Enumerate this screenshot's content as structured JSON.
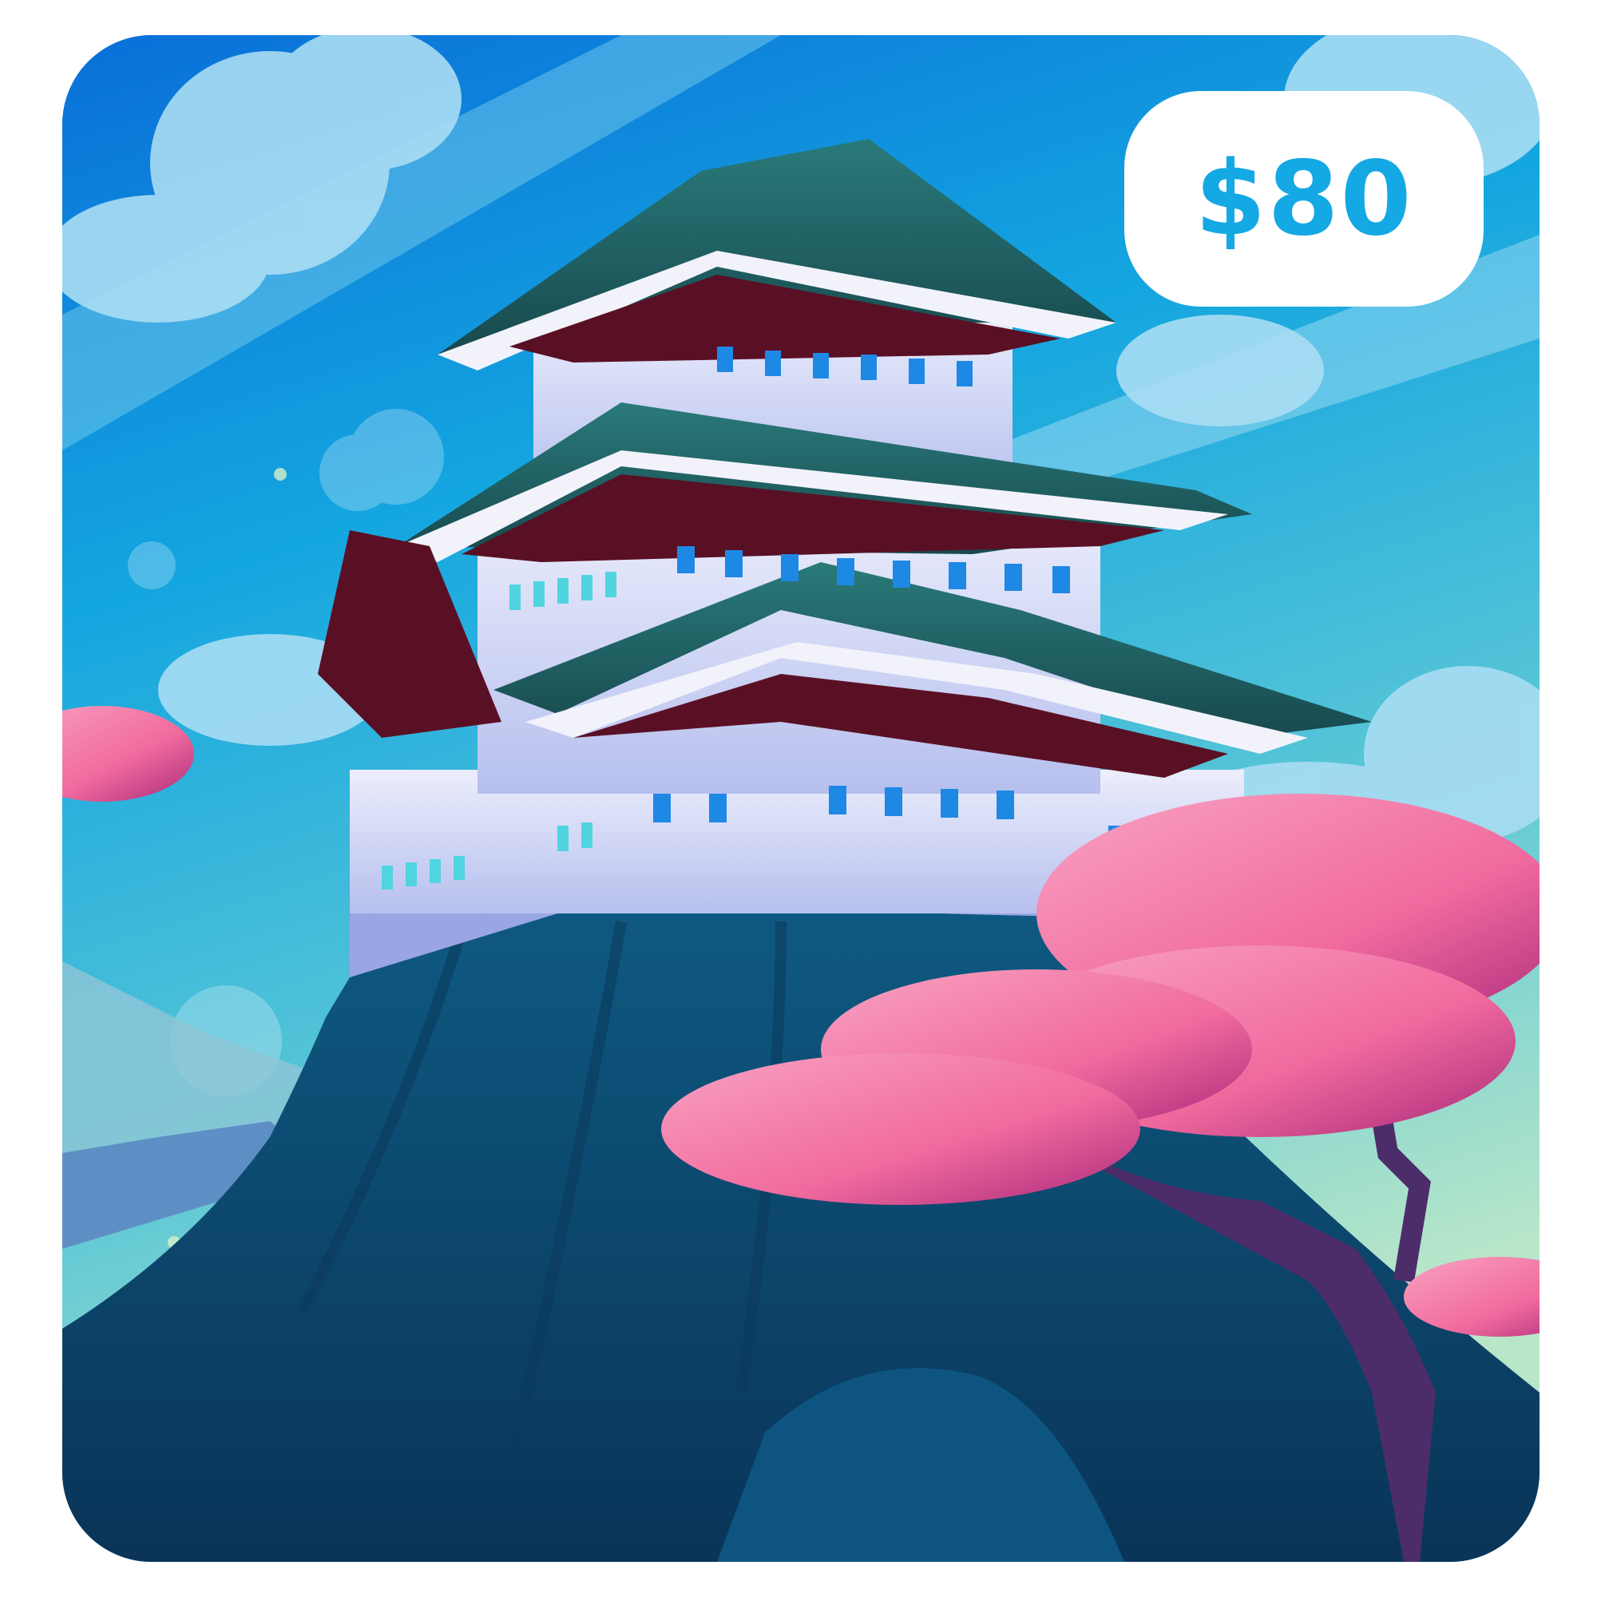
{
  "item": {
    "price": "$80"
  },
  "colors": {
    "price_text": "#14a8e4",
    "badge_background": "#ffffff",
    "sky_top": "#0a74da",
    "blossom": "#f07aa8",
    "rock": "#0f4a70",
    "roof": "#1d5b5e",
    "walls": "#d8dcf6"
  }
}
